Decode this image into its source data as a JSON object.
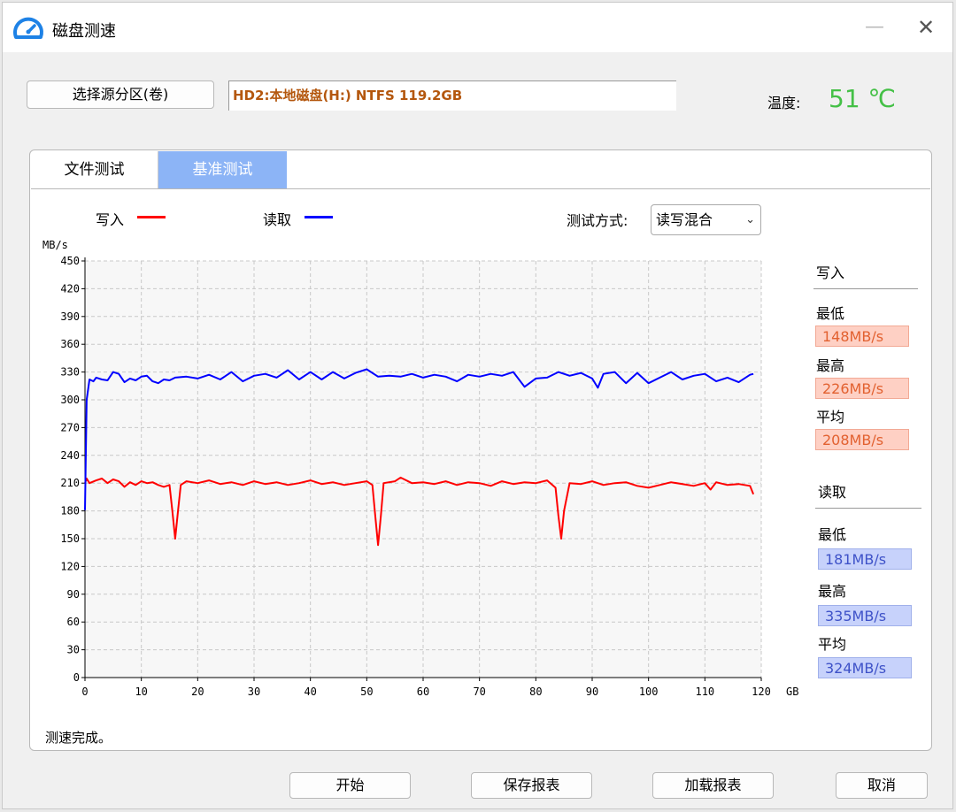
{
  "window": {
    "title": "磁盘测速",
    "icon": "speedometer-icon",
    "minimize_glyph": "—",
    "close_glyph": "✕"
  },
  "source": {
    "button_label": "选择源分区(卷)",
    "drive_value": "HD2:本地磁盘(H:) NTFS 119.2GB",
    "temp_label": "温度:",
    "temp_value": "51 ℃",
    "temp_color": "#44c046"
  },
  "tabs": [
    {
      "label": "文件测试",
      "active": false
    },
    {
      "label": "基准测试",
      "active": true
    }
  ],
  "legend": {
    "write_label": "写入",
    "write_color": "#ff0000",
    "read_label": "读取",
    "read_color": "#0000ff"
  },
  "mode": {
    "label": "测试方式:",
    "value": "读写混合"
  },
  "chart_data": {
    "type": "line",
    "ylabel": "MB/s",
    "xlabel": "GB",
    "xlim": [
      0,
      120
    ],
    "ylim": [
      0,
      450
    ],
    "x_ticks": [
      0,
      10,
      20,
      30,
      40,
      50,
      60,
      70,
      80,
      90,
      100,
      110,
      120
    ],
    "y_ticks": [
      0,
      30,
      60,
      90,
      120,
      150,
      180,
      210,
      240,
      270,
      300,
      330,
      360,
      390,
      420,
      450
    ],
    "grid": true,
    "series": [
      {
        "name": "写入",
        "color": "#ff0000",
        "x": [
          0,
          0.3,
          0.8,
          2,
          3,
          4,
          5,
          6,
          7,
          8,
          9,
          10,
          11,
          12,
          13,
          14,
          15,
          15.5,
          16,
          16.5,
          17,
          18,
          20,
          22,
          24,
          26,
          28,
          30,
          32,
          34,
          36,
          38,
          40,
          42,
          44,
          46,
          48,
          50,
          51,
          51.5,
          52,
          52.5,
          53,
          55,
          56,
          58,
          60,
          62,
          64,
          66,
          68,
          70,
          72,
          74,
          76,
          78,
          80,
          82,
          83.5,
          84,
          84.5,
          85,
          86,
          88,
          90,
          92,
          94,
          96,
          98,
          100,
          102,
          104,
          106,
          108,
          110,
          111,
          112,
          114,
          116,
          118,
          118.6
        ],
        "values": [
          210,
          215,
          210,
          213,
          215,
          210,
          214,
          212,
          206,
          211,
          208,
          212,
          210,
          211,
          208,
          206,
          208,
          180,
          150,
          180,
          208,
          212,
          210,
          213,
          209,
          211,
          208,
          212,
          209,
          211,
          208,
          210,
          213,
          209,
          211,
          208,
          210,
          212,
          208,
          175,
          143,
          175,
          210,
          212,
          216,
          210,
          211,
          209,
          212,
          208,
          211,
          210,
          207,
          212,
          209,
          211,
          210,
          213,
          205,
          175,
          150,
          180,
          210,
          209,
          212,
          208,
          210,
          211,
          207,
          205,
          208,
          211,
          209,
          207,
          210,
          203,
          211,
          208,
          209,
          207,
          198
        ]
      },
      {
        "name": "读取",
        "color": "#0000ff",
        "x": [
          0,
          0.3,
          0.8,
          1.5,
          2,
          3,
          4,
          5,
          6,
          7,
          8,
          9,
          10,
          11,
          12,
          13,
          14,
          15,
          16,
          18,
          20,
          22,
          24,
          26,
          28,
          30,
          32,
          34,
          36,
          38,
          40,
          42,
          44,
          46,
          48,
          50,
          52,
          54,
          56,
          58,
          60,
          62,
          64,
          66,
          68,
          70,
          72,
          74,
          76,
          78,
          80,
          82,
          84,
          86,
          88,
          90,
          91,
          92,
          94,
          96,
          98,
          100,
          102,
          104,
          106,
          108,
          110,
          112,
          114,
          116,
          118,
          118.6
        ],
        "values": [
          181,
          300,
          322,
          320,
          324,
          322,
          321,
          330,
          328,
          319,
          323,
          321,
          325,
          326,
          320,
          318,
          322,
          321,
          324,
          325,
          323,
          327,
          322,
          330,
          320,
          326,
          328,
          324,
          332,
          322,
          330,
          322,
          330,
          323,
          329,
          333,
          325,
          326,
          325,
          328,
          324,
          327,
          325,
          320,
          327,
          325,
          328,
          326,
          330,
          314,
          323,
          324,
          330,
          326,
          329,
          323,
          313,
          328,
          330,
          318,
          329,
          318,
          324,
          330,
          322,
          326,
          328,
          320,
          324,
          319,
          327,
          328
        ]
      }
    ]
  },
  "stats": {
    "write": {
      "title": "写入",
      "min_label": "最低",
      "min_value": "148MB/s",
      "max_label": "最高",
      "max_value": "226MB/s",
      "avg_label": "平均",
      "avg_value": "208MB/s"
    },
    "read": {
      "title": "读取",
      "min_label": "最低",
      "min_value": "181MB/s",
      "max_label": "最高",
      "max_value": "335MB/s",
      "avg_label": "平均",
      "avg_value": "324MB/s"
    }
  },
  "status": "测速完成。",
  "buttons": {
    "start": "开始",
    "save_report": "保存报表",
    "load_report": "加载报表",
    "cancel": "取消"
  }
}
